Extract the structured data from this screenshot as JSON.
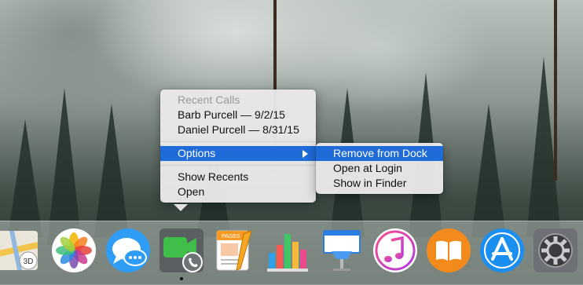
{
  "context_menu": {
    "header": "Recent Calls",
    "recent_calls": [
      "Barb Purcell — 9/2/15",
      "Daniel Purcell — 8/31/15"
    ],
    "options_label": "Options",
    "show_recents_label": "Show Recents",
    "open_label": "Open"
  },
  "options_submenu": {
    "items": [
      "Remove from Dock",
      "Open at Login",
      "Show in Finder"
    ]
  },
  "colors": {
    "highlight": "#1f6cd9",
    "menu_background": "#e8e8e8",
    "disabled_text": "#9a9a9a"
  },
  "dock": {
    "apps": [
      {
        "icon": "maps-icon"
      },
      {
        "icon": "photos-icon"
      },
      {
        "icon": "messages-icon"
      },
      {
        "icon": "facetime-icon"
      },
      {
        "icon": "pages-icon"
      },
      {
        "icon": "numbers-icon"
      },
      {
        "icon": "keynote-icon"
      },
      {
        "icon": "itunes-icon"
      },
      {
        "icon": "ibooks-icon"
      },
      {
        "icon": "app-store-icon"
      },
      {
        "icon": "system-preferences-icon"
      }
    ]
  }
}
